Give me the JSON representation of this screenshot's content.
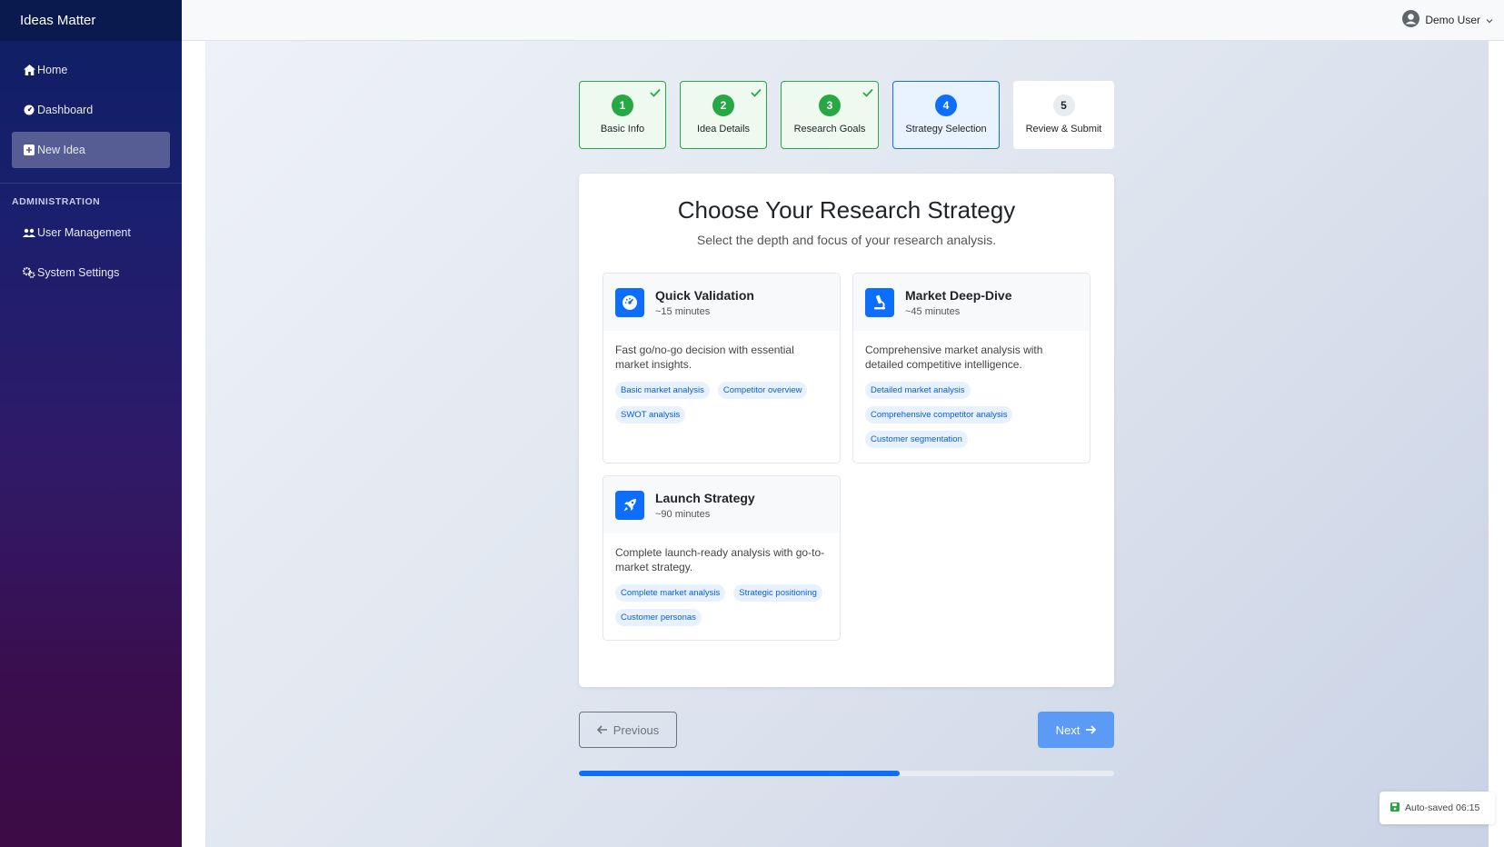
{
  "app": {
    "title": "Ideas Matter"
  },
  "sidebar": {
    "items": [
      {
        "label": "Home",
        "icon": "home-icon"
      },
      {
        "label": "Dashboard",
        "icon": "gauge-icon"
      },
      {
        "label": "New Idea",
        "icon": "plus-square-icon",
        "active": true
      }
    ],
    "admin_heading": "ADMINISTRATION",
    "admin_items": [
      {
        "label": "User Management",
        "icon": "users-icon"
      },
      {
        "label": "System Settings",
        "icon": "gears-icon"
      }
    ]
  },
  "header": {
    "user_name": "Demo User"
  },
  "steps": [
    {
      "number": "1",
      "label": "Basic Info",
      "state": "done"
    },
    {
      "number": "2",
      "label": "Idea Details",
      "state": "done"
    },
    {
      "number": "3",
      "label": "Research Goals",
      "state": "done"
    },
    {
      "number": "4",
      "label": "Strategy Selection",
      "state": "current"
    },
    {
      "number": "5",
      "label": "Review & Submit",
      "state": "todo"
    }
  ],
  "main": {
    "title": "Choose Your Research Strategy",
    "subtitle": "Select the depth and focus of your research analysis.",
    "options": [
      {
        "title": "Quick Validation",
        "duration": "~15 minutes",
        "icon": "gauge-icon",
        "description": "Fast go/no-go decision with essential market insights.",
        "tags": [
          "Basic market analysis",
          "Competitor overview",
          "SWOT analysis"
        ]
      },
      {
        "title": "Market Deep-Dive",
        "duration": "~45 minutes",
        "icon": "microscope-icon",
        "description": "Comprehensive market analysis with detailed competitive intelligence.",
        "tags": [
          "Detailed market analysis",
          "Comprehensive competitor analysis",
          "Customer segmentation"
        ]
      },
      {
        "title": "Launch Strategy",
        "duration": "~90 minutes",
        "icon": "rocket-icon",
        "description": "Complete launch-ready analysis with go-to-market strategy.",
        "tags": [
          "Complete market analysis",
          "Strategic positioning",
          "Customer personas"
        ]
      }
    ]
  },
  "nav_buttons": {
    "previous": "Previous",
    "next": "Next"
  },
  "progress": {
    "value": 0.6
  },
  "autosave": {
    "text": "Auto-saved 06:15"
  },
  "colors": {
    "primary": "#0d6efd",
    "success": "#28a745",
    "next_button": "#5b9bf5"
  }
}
